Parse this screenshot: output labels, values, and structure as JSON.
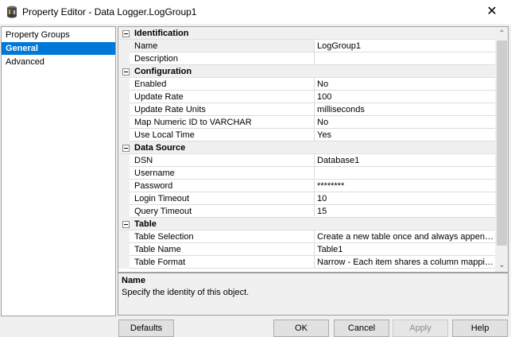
{
  "window": {
    "title": "Property Editor - Data Logger.LogGroup1",
    "close_glyph": "✕"
  },
  "left_panel": {
    "header": "Property Groups",
    "items": [
      {
        "label": "General",
        "selected": true
      },
      {
        "label": "Advanced",
        "selected": false
      }
    ]
  },
  "grid": {
    "categories": [
      {
        "label": "Identification",
        "rows": [
          {
            "name": "Name",
            "value": "LogGroup1"
          },
          {
            "name": "Description",
            "value": ""
          }
        ]
      },
      {
        "label": "Configuration",
        "rows": [
          {
            "name": "Enabled",
            "value": "No"
          },
          {
            "name": "Update Rate",
            "value": "100"
          },
          {
            "name": "Update Rate Units",
            "value": "milliseconds"
          },
          {
            "name": "Map Numeric ID to VARCHAR",
            "value": "No"
          },
          {
            "name": "Use Local Time",
            "value": "Yes"
          }
        ]
      },
      {
        "label": "Data Source",
        "rows": [
          {
            "name": "DSN",
            "value": "Database1"
          },
          {
            "name": "Username",
            "value": ""
          },
          {
            "name": "Password",
            "value": "********"
          },
          {
            "name": "Login Timeout",
            "value": "10"
          },
          {
            "name": "Query Timeout",
            "value": "15"
          }
        ]
      },
      {
        "label": "Table",
        "rows": [
          {
            "name": "Table Selection",
            "value": "Create a new table once and always append..."
          },
          {
            "name": "Table Name",
            "value": "Table1"
          },
          {
            "name": "Table Format",
            "value": "Narrow - Each item shares a column mapping"
          }
        ]
      }
    ]
  },
  "description": {
    "title": "Name",
    "text": "Specify the identity of this object."
  },
  "buttons": {
    "defaults": "Defaults",
    "ok": "OK",
    "cancel": "Cancel",
    "apply": "Apply",
    "help": "Help"
  },
  "scrollbar": {
    "up_glyph": "⌃",
    "down_glyph": "⌄"
  }
}
